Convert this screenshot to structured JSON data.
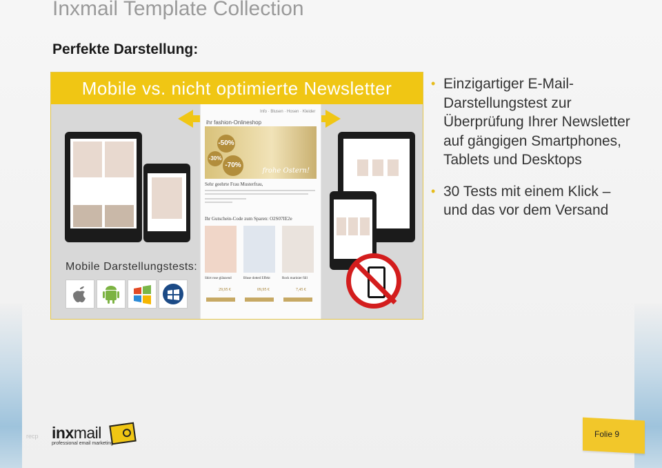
{
  "slide": {
    "title": "Inxmail Template Collection",
    "subtitle": "Perfekte Darstellung:"
  },
  "promo": {
    "banner": "Mobile vs. nicht optimierte Newsletter",
    "mobile_label": "Mobile Darstellungstests:",
    "newsletter": {
      "shop": "ihr fashion-Onlineshop",
      "discount_1": "-50%",
      "discount_2": "-30%",
      "discount_3": "-70%",
      "script": "frohe Ostern!",
      "greeting": "Sehr geehrte Frau Musterfrau,",
      "coupon": "Ihr Gutschein-Code zum Sparen: O2S07IE2e",
      "products": [
        {
          "name": "Shirt rose glänzend",
          "price": "29,95 €"
        },
        {
          "name": "Bluse dotted Effekt",
          "price": "09,95 €"
        },
        {
          "name": "Rock marinier füll",
          "price": "7,45 €"
        }
      ]
    },
    "os_icons": [
      "apple-icon",
      "android-icon",
      "windows-icon",
      "windows-phone-icon"
    ]
  },
  "bullets": [
    "Einzigartiger E-Mail-Darstellungstest  zur Überprüfung Ihrer Newsletter auf gängigen Smartphones, Tablets und Desktops",
    "30 Tests mit einem Klick – und das vor dem Versand"
  ],
  "footer": {
    "logo_name_bold": "inx",
    "logo_name_regular": "mail",
    "logo_tagline": "professional email marketing",
    "watermark": "recp",
    "slide_number": "Folie 9"
  },
  "colors": {
    "accent": "#f0c614",
    "no_sign": "#d31d1d"
  }
}
